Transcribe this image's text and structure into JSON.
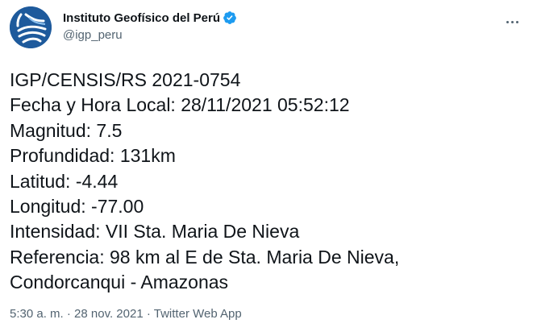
{
  "author": {
    "display_name": "Instituto Geofísico del Perú",
    "handle": "@igp_peru",
    "avatar_icon": "igp-logo-icon",
    "verified_icon": "verified-badge-icon",
    "verified_color": "#1d9bf0"
  },
  "more_icon": "more-options-icon",
  "tweet": {
    "lines": [
      "IGP/CENSIS/RS 2021-0754",
      "Fecha y Hora Local: 28/11/2021 05:52:12",
      "Magnitud: 7.5",
      "Profundidad: 131km",
      "Latitud: -4.44",
      "Longitud: -77.00",
      "Intensidad: VII Sta. Maria De Nieva",
      "Referencia: 98 km al E de Sta. Maria De Nieva,",
      "Condorcanqui - Amazonas"
    ]
  },
  "meta": {
    "time": "5:30 a. m.",
    "separator1": "·",
    "date": "28 nov. 2021",
    "separator2": "·",
    "source": "Twitter Web App"
  },
  "colors": {
    "text": "#0f1419",
    "secondary": "#536471",
    "avatar_bg": "#1e5a9c"
  }
}
